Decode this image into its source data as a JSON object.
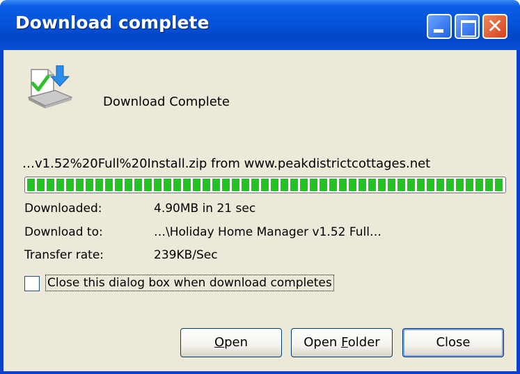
{
  "window": {
    "title": "Download complete",
    "controls": {
      "minimize": "minimize-icon",
      "maximize": "maximize-icon",
      "close": "close-icon"
    }
  },
  "header": {
    "icon": "download-complete-icon",
    "text": "Download Complete"
  },
  "source": "…v1.52%20Full%20Install.zip from www.peakdistrictcottages.net",
  "progress": {
    "percent": 100
  },
  "details": {
    "downloaded_label": "Downloaded:",
    "downloaded_value": "4.90MB in 21 sec",
    "download_to_label": "Download to:",
    "download_to_value": "…\\Holiday Home Manager v1.52 Full…",
    "transfer_rate_label": "Transfer rate:",
    "transfer_rate_value": "239KB/Sec"
  },
  "options": {
    "close_when_complete": {
      "label": "Close this dialog box when download completes",
      "checked": false
    }
  },
  "buttons": {
    "open_first": "O",
    "open_rest": "pen",
    "folder_first": "Open ",
    "folder_key": "F",
    "folder_rest": "older",
    "close": "Close"
  },
  "colors": {
    "titlebar": "#0453d9",
    "dialog_bg": "#ece9d8",
    "progress_fill": "#23c323",
    "close_button": "#d4401b"
  }
}
